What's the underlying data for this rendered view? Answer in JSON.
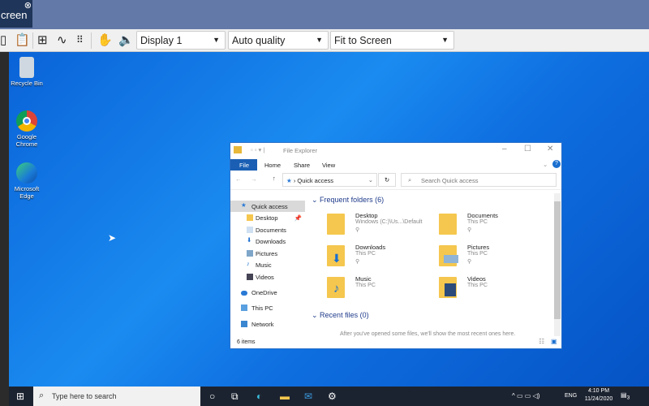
{
  "viewer": {
    "tab_label": "creen",
    "tab_close": "⊗",
    "display_select": "Display 1",
    "quality_select": "Auto quality",
    "scale_select": "Fit to Screen"
  },
  "desktop_icons": [
    {
      "label": "Recycle Bin"
    },
    {
      "label": "Google Chrome"
    },
    {
      "label": "Microsoft Edge"
    }
  ],
  "explorer": {
    "title": "File Explorer",
    "ribbon_tabs": [
      "File",
      "Home",
      "Share",
      "View"
    ],
    "address": "Quick access",
    "search_placeholder": "Search Quick access",
    "nav": [
      "Quick access",
      "Desktop",
      "Documents",
      "Downloads",
      "Pictures",
      "Music",
      "Videos",
      "OneDrive",
      "This PC",
      "Network"
    ],
    "frequent_header": "Frequent folders (6)",
    "folders": [
      {
        "name": "Desktop",
        "sub": "Windows (C:)\\Us...\\Default"
      },
      {
        "name": "Documents",
        "sub": "This PC"
      },
      {
        "name": "Downloads",
        "sub": "This PC"
      },
      {
        "name": "Pictures",
        "sub": "This PC"
      },
      {
        "name": "Music",
        "sub": "This PC"
      },
      {
        "name": "Videos",
        "sub": "This PC"
      }
    ],
    "recent_header": "Recent files (0)",
    "recent_empty": "After you've opened some files, we'll show the most recent ones here.",
    "status": "6 items"
  },
  "taskbar": {
    "search_placeholder": "Type here to search",
    "lang": "ENG",
    "time": "4:10 PM",
    "date": "11/24/2020",
    "notif_count": "3"
  }
}
